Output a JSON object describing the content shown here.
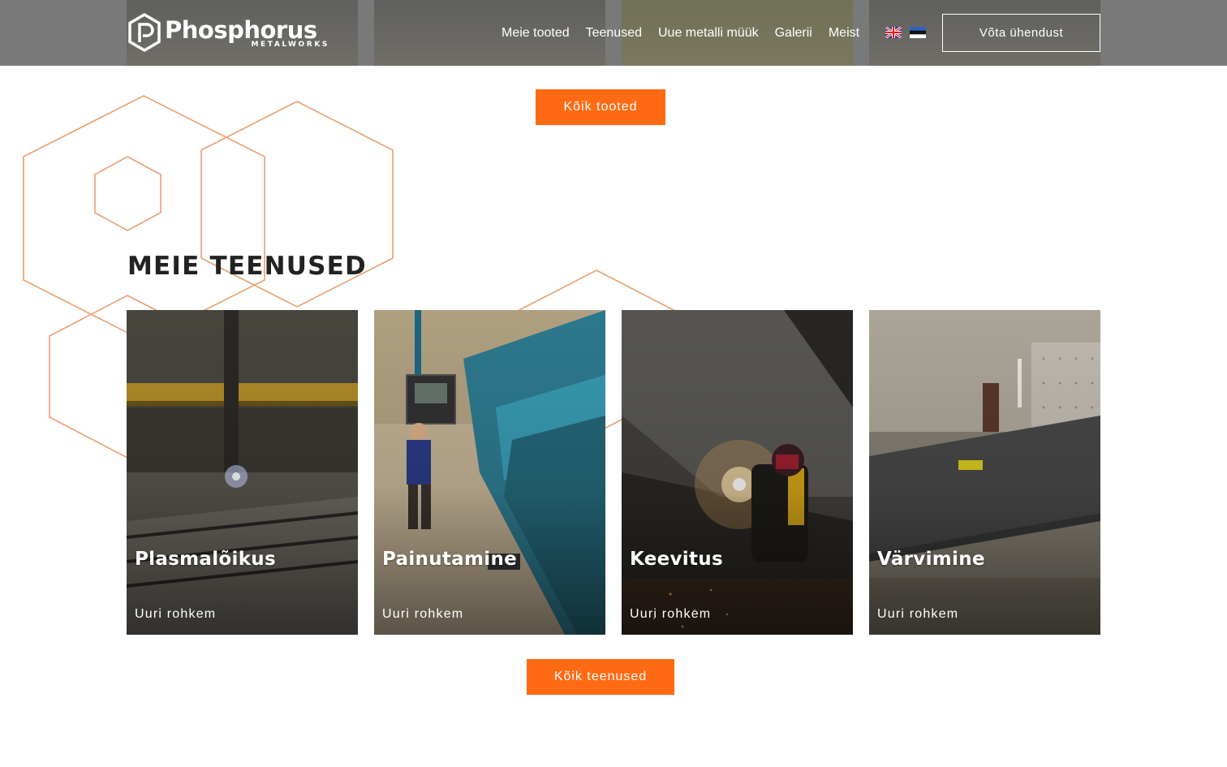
{
  "header": {
    "logo": {
      "word": "Phosphorus",
      "sub": "METALWORKS",
      "icon": "phosphorus-hex-logo-icon"
    },
    "nav": [
      {
        "label": "Meie tooted"
      },
      {
        "label": "Teenused"
      },
      {
        "label": "Uue metalli müük"
      },
      {
        "label": "Galerii"
      },
      {
        "label": "Meist"
      }
    ],
    "languages": [
      {
        "icon": "uk-flag-icon"
      },
      {
        "icon": "estonia-flag-icon"
      }
    ],
    "contact_button": "Võta ühendust"
  },
  "products_button": "Kõik tooted",
  "services": {
    "title": "MEIE TEENUSED",
    "cards": [
      {
        "title": "Plasmalõikus",
        "link": "Uuri rohkem"
      },
      {
        "title": "Painutamine",
        "link": "Uuri rohkem"
      },
      {
        "title": "Keevitus",
        "link": "Uuri rohkem"
      },
      {
        "title": "Värvimine",
        "link": "Uuri rohkem"
      }
    ],
    "all_button": "Kõik teenused"
  },
  "colors": {
    "accent": "#ff6a13",
    "hex_outline": "#e8a070",
    "header_bg": "#6e6e6e"
  }
}
